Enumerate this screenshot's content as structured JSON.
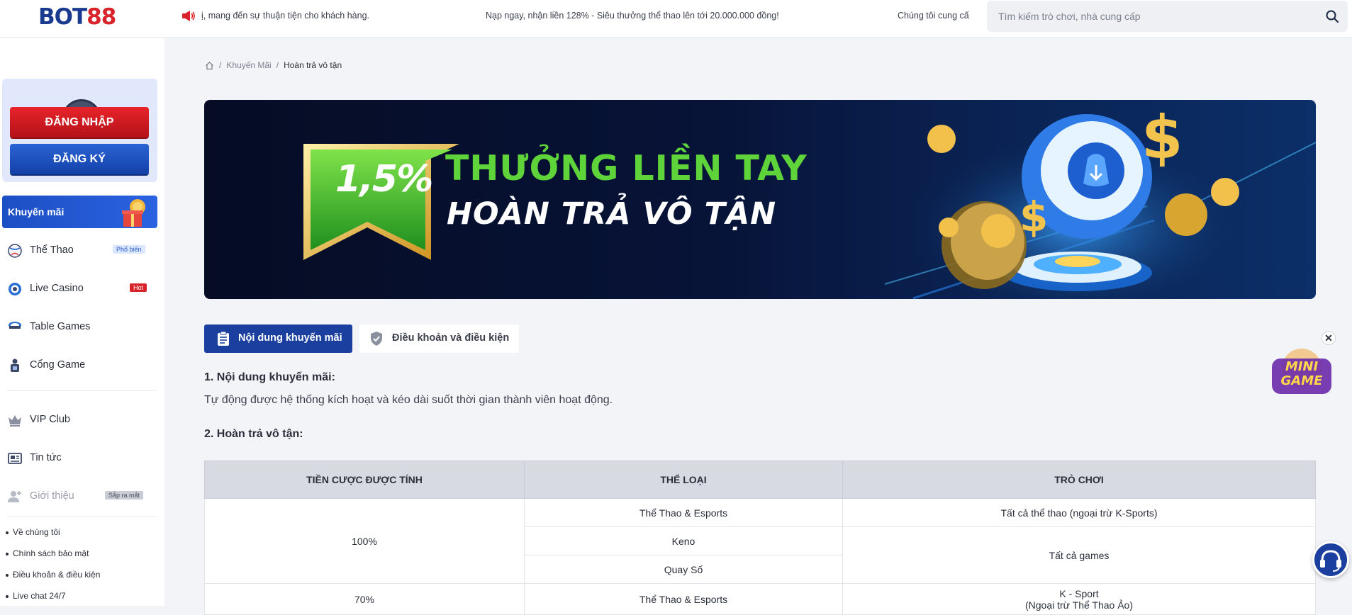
{
  "header": {
    "logo_part1": "B",
    "logo_part2": "O",
    "logo_part3": "T",
    "logo_part4": "88",
    "marquee": [
      "ị, mang đến sự thuận tiện cho khách hàng.",
      "Nạp ngay, nhận liền 128% - Siêu thưởng thể thao lên tới 20.000.000 đồng!",
      "Chúng tôi cung cấ"
    ],
    "search_placeholder": "Tìm kiếm trò chơi, nhà cung cấp"
  },
  "sidebar": {
    "login_label": "ĐĂNG NHẬP",
    "register_label": "ĐĂNG KÝ",
    "promo_label": "Khuyến mãi",
    "items": [
      {
        "label": "Thể Thao",
        "badge": "Phổ biến"
      },
      {
        "label": "Live Casino",
        "badge": "Hot"
      },
      {
        "label": "Table Games",
        "badge": ""
      },
      {
        "label": "Cổng Game",
        "badge": ""
      },
      {
        "label": "VIP Club",
        "badge": ""
      },
      {
        "label": "Tin tức",
        "badge": ""
      },
      {
        "label": "Giới thiệu",
        "badge": "Sắp ra mắt"
      }
    ],
    "footer_links": [
      "Về chúng tôi",
      "Chính sách bảo mật",
      "Điều khoản & điều kiện",
      "Live chat 24/7"
    ]
  },
  "breadcrumb": {
    "items": [
      "Khuyến Mãi",
      "Hoàn trả vô tận"
    ]
  },
  "banner": {
    "percent": "1,5%",
    "headline": "THƯỞNG LIỀN TAY",
    "subheadline": "HOÀN TRẢ VÔ TẬN"
  },
  "tabs": {
    "content_label": "Nội dung khuyến mãi",
    "terms_label": "Điều khoản và điều kiện"
  },
  "content": {
    "section1_title": "1. Nội dung khuyến mãi:",
    "section1_text": "Tự động được hệ thống kích hoạt và kéo dài suốt thời gian thành viên hoạt động.",
    "section2_title": "2. Hoàn trả vô tận:"
  },
  "table": {
    "headers": [
      "TIỀN CƯỢC ĐƯỢC TÍNH",
      "THỂ LOẠI",
      "TRÒ CHƠI"
    ],
    "row1_rate": "100%",
    "row1_categories": [
      "Thể Thao & Esports",
      "Keno",
      "Quay Số"
    ],
    "row1_game_a": "Tất cả thể thao (ngoại trừ K-Sports)",
    "row1_game_b": "Tất cả games",
    "row2_rate": "70%",
    "row2_category": "Thể Thao & Esports",
    "row2_game_line1": "K - Sport",
    "row2_game_line2": "(Ngoại trừ Thể Thao Ảo)"
  },
  "widgets": {
    "close_glyph": "✕",
    "minigame_line1": "MINI",
    "minigame_line2": "GAME"
  }
}
